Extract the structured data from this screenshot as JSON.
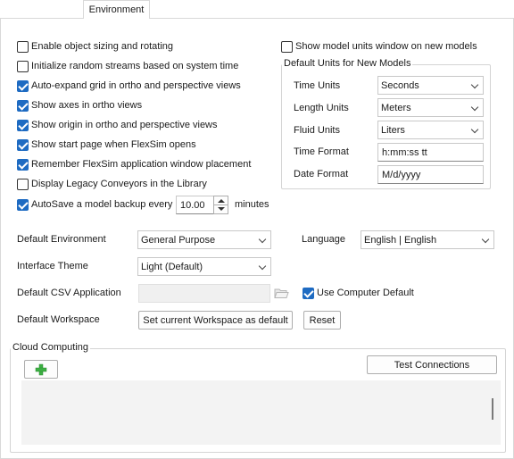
{
  "tab": {
    "label": "Environment"
  },
  "checkboxes_left": [
    {
      "label": "Enable object sizing and rotating",
      "checked": false
    },
    {
      "label": "Initialize random streams based on system time",
      "checked": false
    },
    {
      "label": "Auto-expand grid in ortho and perspective views",
      "checked": true
    },
    {
      "label": "Show axes in ortho views",
      "checked": true
    },
    {
      "label": "Show origin in ortho and perspective views",
      "checked": true
    },
    {
      "label": "Show start page when FlexSim opens",
      "checked": true
    },
    {
      "label": "Remember FlexSim application window placement",
      "checked": true
    },
    {
      "label": "Display Legacy Conveyors in the Library",
      "checked": false
    }
  ],
  "autosave": {
    "label": "AutoSave a model backup every",
    "checked": true,
    "value": "10.00",
    "unit": "minutes"
  },
  "units_window": {
    "label": "Show model units window on new models",
    "checked": false
  },
  "default_units": {
    "title": "Default Units for New Models",
    "time_units": {
      "label": "Time Units",
      "value": "Seconds"
    },
    "length_units": {
      "label": "Length Units",
      "value": "Meters"
    },
    "fluid_units": {
      "label": "Fluid Units",
      "value": "Liters"
    },
    "time_format": {
      "label": "Time Format",
      "value": "h:mm:ss tt"
    },
    "date_format": {
      "label": "Date Format",
      "value": "M/d/yyyy"
    }
  },
  "default_environment": {
    "label": "Default Environment",
    "value": "General Purpose"
  },
  "language": {
    "label": "Language",
    "value": "English | English"
  },
  "interface_theme": {
    "label": "Interface Theme",
    "value": "Light (Default)"
  },
  "csv_app": {
    "label": "Default CSV Application",
    "use_default_label": "Use Computer Default",
    "use_default_checked": true
  },
  "workspace": {
    "label": "Default Workspace",
    "set_button": "Set current Workspace as default",
    "reset_button": "Reset"
  },
  "cloud": {
    "title": "Cloud Computing",
    "test_button": "Test Connections"
  },
  "colors": {
    "accent": "#1e6bc2",
    "add_green": "#3cb043"
  }
}
